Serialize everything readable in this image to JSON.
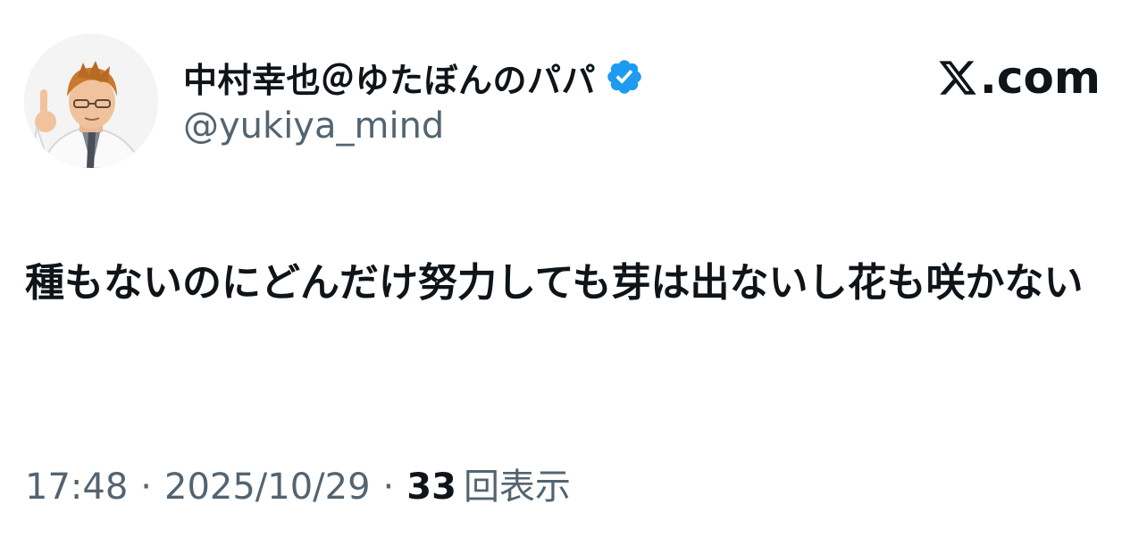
{
  "post": {
    "author": {
      "display_name": "中村幸也＠ゆたぼんのパパ",
      "handle": "@yukiya_mind",
      "verified": true,
      "avatar_icon": "profile-photo"
    },
    "brand": {
      "icon": "x-logo-icon",
      "label": ".com"
    },
    "text": "種もないのにどんだけ努力しても芽は出ないし花も咲かない",
    "meta": {
      "time": "17:48",
      "separator": "·",
      "date": "2025/10/29",
      "views_count": "33",
      "views_label": "回表示"
    }
  },
  "colors": {
    "primary_text": "#0f1419",
    "secondary_text": "#536471",
    "verified_blue": "#1d9bf0"
  }
}
